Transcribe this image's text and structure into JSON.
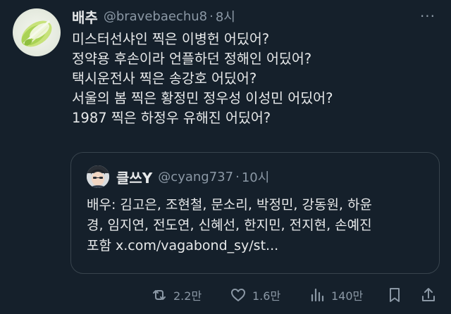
{
  "tweet": {
    "display_name": "배추",
    "handle": "@bravebaechu8",
    "separator": "·",
    "time": "8시",
    "avatar_icon": "napa-cabbage",
    "more_label": "···",
    "lines": [
      "미스터선샤인 찍은 이병헌 어딨어?",
      "정약용 후손이라 언플하던 정해인 어딨어?",
      "택시운전사 찍은 송강호 어딨어?",
      "서울의 봄 찍은 황정민 정우성 이성민 어딨어?",
      "1987 찍은 하정우 유해진 어딨어?"
    ]
  },
  "quote": {
    "display_name": "클쓰Y",
    "handle": "@cyang737",
    "separator": "·",
    "time": "10시",
    "avatar_icon": "person-photo",
    "lines": [
      "배우: 김고은, 조현철, 문소리, 박정민, 강동원, 하윤",
      "경, 임지연, 전도연, 신혜선, 한지민, 전지현, 손예진",
      "포함 x.com/vagabond_sy/st..."
    ]
  },
  "actions": {
    "retweet_count": "2.2만",
    "like_count": "1.6만",
    "views_count": "140만"
  },
  "colors": {
    "background": "#15202b",
    "text": "#e7e9ea",
    "secondary": "#8b98a5",
    "border": "#38444d"
  }
}
